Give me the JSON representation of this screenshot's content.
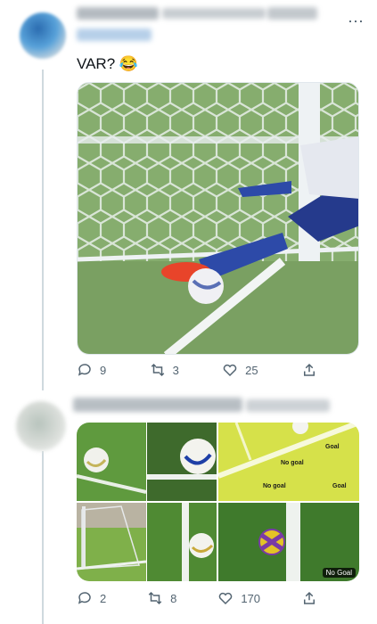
{
  "tweet1": {
    "text": "VAR? 😂",
    "stats": {
      "replies": "9",
      "retweets": "3",
      "likes": "25"
    }
  },
  "tweet2": {
    "stats": {
      "replies": "2",
      "retweets": "8",
      "likes": "170"
    },
    "media": {
      "labels": {
        "goal_a": "Goal",
        "goal_b": "Goal",
        "no_goal_a": "No goal",
        "no_goal_b": "No goal",
        "tag": "No Goal"
      }
    }
  },
  "icons": [
    "reply-icon",
    "retweet-icon",
    "like-icon",
    "share-icon",
    "more-icon"
  ]
}
